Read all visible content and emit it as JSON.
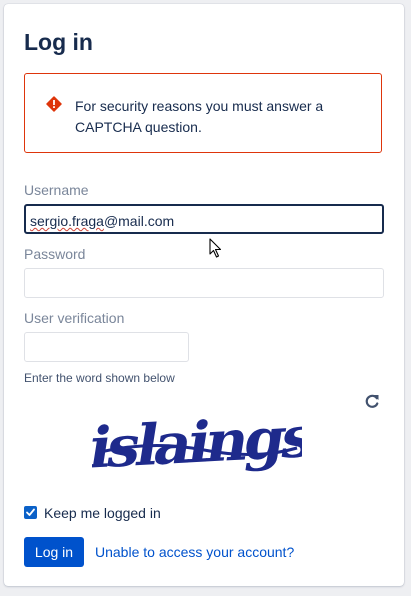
{
  "page": {
    "title": "Log in"
  },
  "alert": {
    "icon": "error-icon",
    "color": "#de350b",
    "message": "For security reasons you must answer a CAPTCHA question."
  },
  "form": {
    "username": {
      "label": "Username",
      "value": "sergio.fraga@mail.com",
      "local_part": "sergio.fraga",
      "domain_part": "@mail.com"
    },
    "password": {
      "label": "Password",
      "value": ""
    },
    "verification": {
      "label": "User verification",
      "value": "",
      "hint": "Enter the word shown below",
      "refresh_icon": "refresh-icon",
      "captcha_text": "islaings",
      "captcha_color": "#1e2a8c"
    },
    "remember": {
      "label": "Keep me logged in",
      "checked": true
    },
    "submit_label": "Log in",
    "help_link": "Unable to access your account?"
  },
  "colors": {
    "primary": "#0052cc",
    "error": "#de350b",
    "text": "#172b4d",
    "muted": "#7a869a"
  }
}
